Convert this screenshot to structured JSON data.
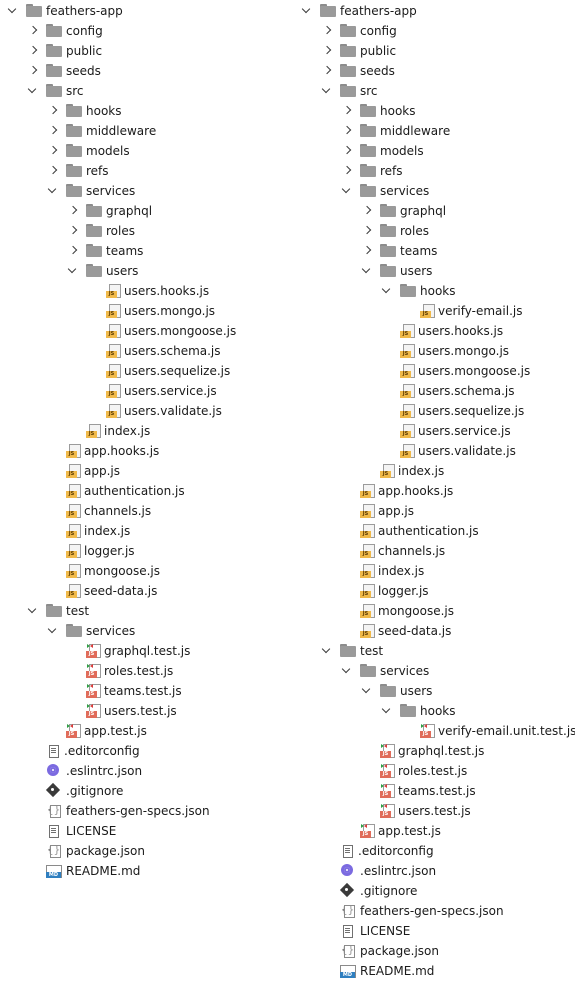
{
  "left_tree": {
    "rows": [
      {
        "label": "feathers-app",
        "depth": 0,
        "kind": "folder",
        "state": "expanded"
      },
      {
        "label": "config",
        "depth": 1,
        "kind": "folder",
        "state": "collapsed"
      },
      {
        "label": "public",
        "depth": 1,
        "kind": "folder",
        "state": "collapsed"
      },
      {
        "label": "seeds",
        "depth": 1,
        "kind": "folder",
        "state": "collapsed"
      },
      {
        "label": "src",
        "depth": 1,
        "kind": "folder",
        "state": "expanded"
      },
      {
        "label": "hooks",
        "depth": 2,
        "kind": "folder",
        "state": "collapsed"
      },
      {
        "label": "middleware",
        "depth": 2,
        "kind": "folder",
        "state": "collapsed"
      },
      {
        "label": "models",
        "depth": 2,
        "kind": "folder",
        "state": "collapsed"
      },
      {
        "label": "refs",
        "depth": 2,
        "kind": "folder",
        "state": "collapsed"
      },
      {
        "label": "services",
        "depth": 2,
        "kind": "folder",
        "state": "expanded"
      },
      {
        "label": "graphql",
        "depth": 3,
        "kind": "folder",
        "state": "collapsed"
      },
      {
        "label": "roles",
        "depth": 3,
        "kind": "folder",
        "state": "collapsed"
      },
      {
        "label": "teams",
        "depth": 3,
        "kind": "folder",
        "state": "collapsed"
      },
      {
        "label": "users",
        "depth": 3,
        "kind": "folder",
        "state": "expanded"
      },
      {
        "label": "users.hooks.js",
        "depth": 4,
        "kind": "js"
      },
      {
        "label": "users.mongo.js",
        "depth": 4,
        "kind": "js"
      },
      {
        "label": "users.mongoose.js",
        "depth": 4,
        "kind": "js"
      },
      {
        "label": "users.schema.js",
        "depth": 4,
        "kind": "js"
      },
      {
        "label": "users.sequelize.js",
        "depth": 4,
        "kind": "js"
      },
      {
        "label": "users.service.js",
        "depth": 4,
        "kind": "js"
      },
      {
        "label": "users.validate.js",
        "depth": 4,
        "kind": "js"
      },
      {
        "label": "index.js",
        "depth": 3,
        "kind": "js"
      },
      {
        "label": "app.hooks.js",
        "depth": 2,
        "kind": "js"
      },
      {
        "label": "app.js",
        "depth": 2,
        "kind": "js"
      },
      {
        "label": "authentication.js",
        "depth": 2,
        "kind": "js"
      },
      {
        "label": "channels.js",
        "depth": 2,
        "kind": "js"
      },
      {
        "label": "index.js",
        "depth": 2,
        "kind": "js"
      },
      {
        "label": "logger.js",
        "depth": 2,
        "kind": "js"
      },
      {
        "label": "mongoose.js",
        "depth": 2,
        "kind": "js"
      },
      {
        "label": "seed-data.js",
        "depth": 2,
        "kind": "js"
      },
      {
        "label": "test",
        "depth": 1,
        "kind": "folder",
        "state": "expanded"
      },
      {
        "label": "services",
        "depth": 2,
        "kind": "folder",
        "state": "expanded"
      },
      {
        "label": "graphql.test.js",
        "depth": 3,
        "kind": "test"
      },
      {
        "label": "roles.test.js",
        "depth": 3,
        "kind": "test"
      },
      {
        "label": "teams.test.js",
        "depth": 3,
        "kind": "test"
      },
      {
        "label": "users.test.js",
        "depth": 3,
        "kind": "test"
      },
      {
        "label": "app.test.js",
        "depth": 2,
        "kind": "test"
      },
      {
        "label": ".editorconfig",
        "depth": 1,
        "kind": "cfg"
      },
      {
        "label": ".eslintrc.json",
        "depth": 1,
        "kind": "eslint"
      },
      {
        "label": ".gitignore",
        "depth": 1,
        "kind": "git"
      },
      {
        "label": "feathers-gen-specs.json",
        "depth": 1,
        "kind": "json"
      },
      {
        "label": "LICENSE",
        "depth": 1,
        "kind": "license"
      },
      {
        "label": "package.json",
        "depth": 1,
        "kind": "json"
      },
      {
        "label": "README.md",
        "depth": 1,
        "kind": "md"
      }
    ]
  },
  "right_tree": {
    "rows": [
      {
        "label": "feathers-app",
        "depth": 0,
        "kind": "folder",
        "state": "expanded"
      },
      {
        "label": "config",
        "depth": 1,
        "kind": "folder",
        "state": "collapsed"
      },
      {
        "label": "public",
        "depth": 1,
        "kind": "folder",
        "state": "collapsed"
      },
      {
        "label": "seeds",
        "depth": 1,
        "kind": "folder",
        "state": "collapsed"
      },
      {
        "label": "src",
        "depth": 1,
        "kind": "folder",
        "state": "expanded"
      },
      {
        "label": "hooks",
        "depth": 2,
        "kind": "folder",
        "state": "collapsed"
      },
      {
        "label": "middleware",
        "depth": 2,
        "kind": "folder",
        "state": "collapsed"
      },
      {
        "label": "models",
        "depth": 2,
        "kind": "folder",
        "state": "collapsed"
      },
      {
        "label": "refs",
        "depth": 2,
        "kind": "folder",
        "state": "collapsed"
      },
      {
        "label": "services",
        "depth": 2,
        "kind": "folder",
        "state": "expanded"
      },
      {
        "label": "graphql",
        "depth": 3,
        "kind": "folder",
        "state": "collapsed"
      },
      {
        "label": "roles",
        "depth": 3,
        "kind": "folder",
        "state": "collapsed"
      },
      {
        "label": "teams",
        "depth": 3,
        "kind": "folder",
        "state": "collapsed"
      },
      {
        "label": "users",
        "depth": 3,
        "kind": "folder",
        "state": "expanded"
      },
      {
        "label": "hooks",
        "depth": 4,
        "kind": "folder",
        "state": "expanded"
      },
      {
        "label": "verify-email.js",
        "depth": 5,
        "kind": "js"
      },
      {
        "label": "users.hooks.js",
        "depth": 4,
        "kind": "js"
      },
      {
        "label": "users.mongo.js",
        "depth": 4,
        "kind": "js"
      },
      {
        "label": "users.mongoose.js",
        "depth": 4,
        "kind": "js"
      },
      {
        "label": "users.schema.js",
        "depth": 4,
        "kind": "js"
      },
      {
        "label": "users.sequelize.js",
        "depth": 4,
        "kind": "js"
      },
      {
        "label": "users.service.js",
        "depth": 4,
        "kind": "js"
      },
      {
        "label": "users.validate.js",
        "depth": 4,
        "kind": "js"
      },
      {
        "label": "index.js",
        "depth": 3,
        "kind": "js"
      },
      {
        "label": "app.hooks.js",
        "depth": 2,
        "kind": "js"
      },
      {
        "label": "app.js",
        "depth": 2,
        "kind": "js"
      },
      {
        "label": "authentication.js",
        "depth": 2,
        "kind": "js"
      },
      {
        "label": "channels.js",
        "depth": 2,
        "kind": "js"
      },
      {
        "label": "index.js",
        "depth": 2,
        "kind": "js"
      },
      {
        "label": "logger.js",
        "depth": 2,
        "kind": "js"
      },
      {
        "label": "mongoose.js",
        "depth": 2,
        "kind": "js"
      },
      {
        "label": "seed-data.js",
        "depth": 2,
        "kind": "js"
      },
      {
        "label": "test",
        "depth": 1,
        "kind": "folder",
        "state": "expanded"
      },
      {
        "label": "services",
        "depth": 2,
        "kind": "folder",
        "state": "expanded"
      },
      {
        "label": "users",
        "depth": 3,
        "kind": "folder",
        "state": "expanded"
      },
      {
        "label": "hooks",
        "depth": 4,
        "kind": "folder",
        "state": "expanded"
      },
      {
        "label": "verify-email.unit.test.js",
        "depth": 5,
        "kind": "test"
      },
      {
        "label": "graphql.test.js",
        "depth": 3,
        "kind": "test"
      },
      {
        "label": "roles.test.js",
        "depth": 3,
        "kind": "test"
      },
      {
        "label": "teams.test.js",
        "depth": 3,
        "kind": "test"
      },
      {
        "label": "users.test.js",
        "depth": 3,
        "kind": "test"
      },
      {
        "label": "app.test.js",
        "depth": 2,
        "kind": "test"
      },
      {
        "label": ".editorconfig",
        "depth": 1,
        "kind": "cfg"
      },
      {
        "label": ".eslintrc.json",
        "depth": 1,
        "kind": "eslint"
      },
      {
        "label": ".gitignore",
        "depth": 1,
        "kind": "git"
      },
      {
        "label": "feathers-gen-specs.json",
        "depth": 1,
        "kind": "json"
      },
      {
        "label": "LICENSE",
        "depth": 1,
        "kind": "license"
      },
      {
        "label": "package.json",
        "depth": 1,
        "kind": "json"
      },
      {
        "label": "README.md",
        "depth": 1,
        "kind": "md"
      }
    ]
  }
}
